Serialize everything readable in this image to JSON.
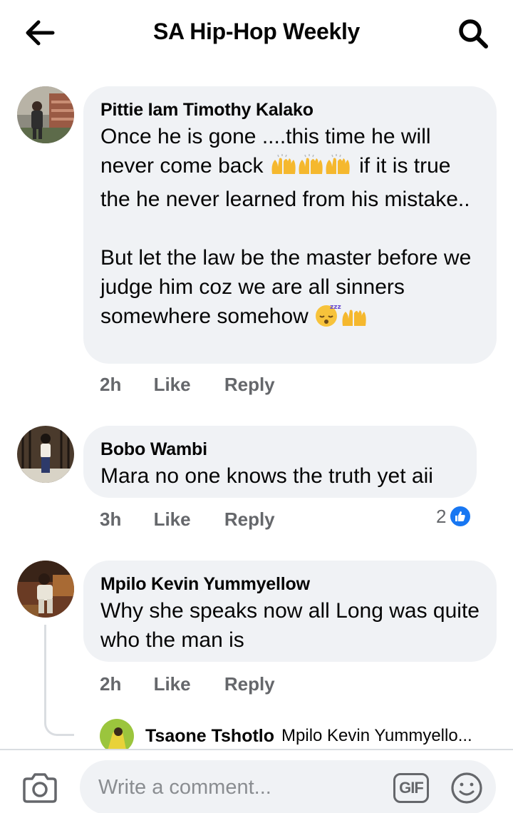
{
  "header": {
    "title": "SA Hip-Hop Weekly",
    "back_icon": "arrow-left-icon",
    "search_icon": "search-icon"
  },
  "comments": [
    {
      "author": "Pittie Iam Timothy Kalako",
      "text_part1": "Once he is gone ....this time he will never come back",
      "text_part2": " if it is true the he never learned from his mistake..",
      "text_part3": "But let the law be the master before we judge him coz we are all sinners somewhere somehow",
      "time": "2h",
      "like_label": "Like",
      "reply_label": "Reply"
    },
    {
      "author": "Bobo Wambi",
      "text": "Mara no one knows the truth yet aii",
      "time": "3h",
      "like_label": "Like",
      "reply_label": "Reply",
      "reaction_count": "2"
    },
    {
      "author": "Mpilo Kevin Yummyellow",
      "text": "Why she speaks now all Long was quite who the man is",
      "time": "2h",
      "like_label": "Like",
      "reply_label": "Reply",
      "reply_preview": {
        "author": "Tsaone Tshotlo",
        "snippet": "Mpilo Kevin Yummyello..."
      }
    }
  ],
  "composer": {
    "placeholder": "Write a comment...",
    "gif_label": "GIF"
  },
  "colors": {
    "bubble": "#f0f2f5",
    "meta_text": "#65676b",
    "like_blue": "#1877f2"
  }
}
